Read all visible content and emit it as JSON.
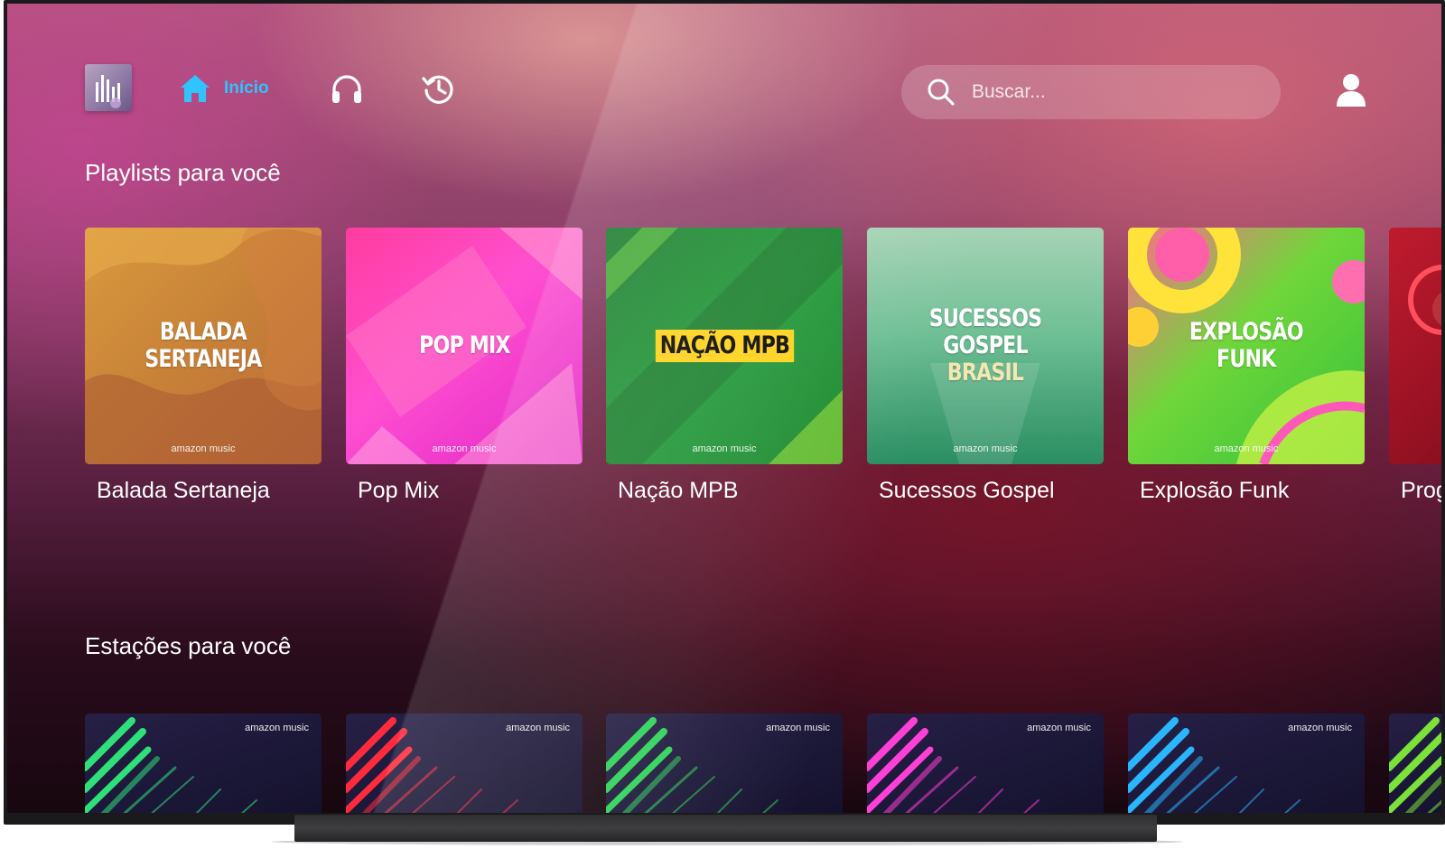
{
  "nav": {
    "home_label": "Início",
    "search_placeholder": "Buscar...",
    "accent_color": "#2fc3ff"
  },
  "sections": {
    "playlists_title": "Playlists para você",
    "stations_title": "Estações para você"
  },
  "playlists": [
    {
      "cover_lines": [
        "BALADA",
        "SERTANEJA"
      ],
      "brand": "amazon music",
      "label": "Balada Sertaneja"
    },
    {
      "cover_lines": [
        "POP MIX"
      ],
      "brand": "amazon music",
      "label": "Pop Mix"
    },
    {
      "cover_lines": [
        "NAÇÃO MPB"
      ],
      "brand": "amazon music",
      "label": "Nação MPB"
    },
    {
      "cover_lines": [
        "SUCESSOS GOSPEL",
        "BRASIL"
      ],
      "brand": "amazon music",
      "label": "Sucessos Gospel"
    },
    {
      "cover_lines": [
        "EXPLOSÃO",
        "FUNK"
      ],
      "brand": "amazon music",
      "label": "Explosão Funk"
    },
    {
      "cover_lines": [],
      "brand": "",
      "label": "Prog"
    }
  ],
  "stations": [
    {
      "brand": "amazon music",
      "stripe_color": "#2fe07a"
    },
    {
      "brand": "amazon music",
      "stripe_color": "#ff2a3a"
    },
    {
      "brand": "amazon music",
      "stripe_color": "#2fd35a"
    },
    {
      "brand": "amazon music",
      "stripe_color": "#ff3fd6"
    },
    {
      "brand": "amazon music",
      "stripe_color": "#2ab5ff"
    },
    {
      "brand": "",
      "stripe_color": "#7be23a"
    }
  ],
  "icons": [
    "equalizer-logo-icon",
    "home-icon",
    "headphones-icon",
    "history-icon",
    "search-icon",
    "user-icon"
  ]
}
